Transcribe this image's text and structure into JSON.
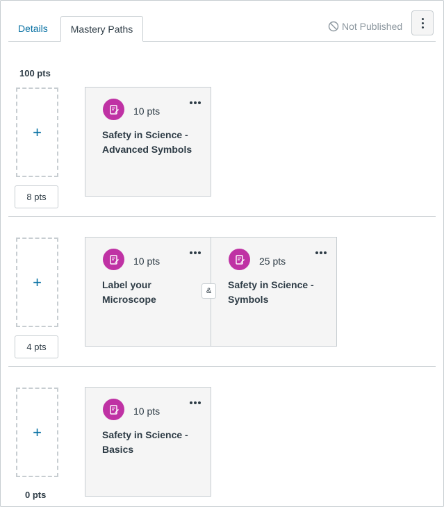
{
  "tabs": {
    "details": "Details",
    "mastery_paths": "Mastery Paths"
  },
  "header": {
    "publish_status": "Not Published"
  },
  "scores": {
    "top": "100 pts",
    "bottom": "0 pts"
  },
  "ranges": [
    {
      "lower_bound": "8 pts",
      "assignments": [
        {
          "points": "10 pts",
          "title": "Safety in Science - Advanced Symbols"
        }
      ]
    },
    {
      "lower_bound": "4 pts",
      "assignments": [
        {
          "points": "10 pts",
          "title": "Label your Microscope"
        },
        {
          "points": "25 pts",
          "title": "Safety in Science - Symbols"
        }
      ],
      "joiner": "&"
    },
    {
      "assignments": [
        {
          "points": "10 pts",
          "title": "Safety in Science - Basics"
        }
      ]
    }
  ],
  "add_label": "+",
  "colors": {
    "link": "#0770a3",
    "assignment_icon": "#bf32a4",
    "border": "#c7cdd1"
  },
  "icons": {
    "status": "not-published-icon",
    "menu": "kebab-menu-icon",
    "assignment": "quiz-icon",
    "card_menu": "more-options-icon"
  }
}
